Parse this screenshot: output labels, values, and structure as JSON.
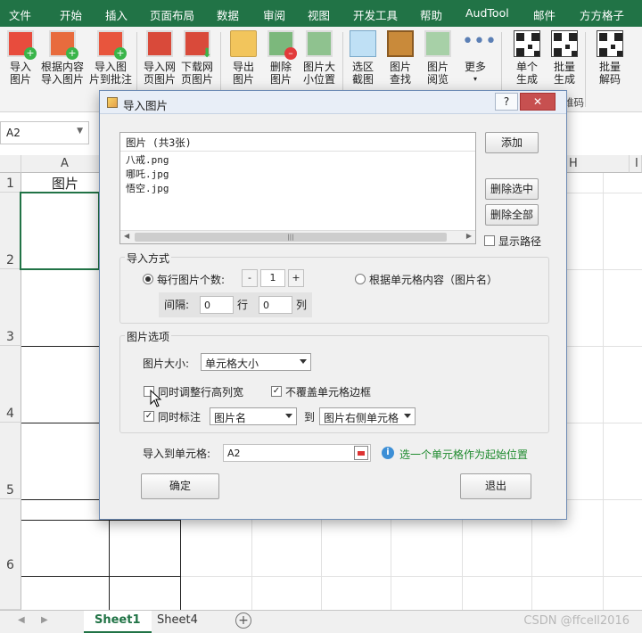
{
  "menubar": {
    "items": [
      "文件",
      "开始",
      "插入",
      "页面布局",
      "数据",
      "审阅",
      "视图",
      "开发工具",
      "帮助",
      "AudTool",
      "邮件",
      "方方格子"
    ]
  },
  "ribbon": {
    "buttons": [
      {
        "line1": "导入",
        "line2": "图片",
        "icon": "import-image-icon"
      },
      {
        "line1": "根据内容",
        "line2": "导入图片",
        "icon": "import-by-content-icon"
      },
      {
        "line1": "导入图",
        "line2": "片到批注",
        "icon": "image-to-comment-icon"
      },
      {
        "line1": "导入网",
        "line2": "页图片",
        "icon": "import-web-image-icon"
      },
      {
        "line1": "下载网",
        "line2": "页图片",
        "icon": "download-web-image-icon"
      },
      {
        "line1": "导出",
        "line2": "图片",
        "icon": "export-image-icon"
      },
      {
        "line1": "删除",
        "line2": "图片",
        "icon": "delete-image-icon"
      },
      {
        "line1": "图片大",
        "line2": "小位置",
        "icon": "image-size-position-icon"
      },
      {
        "line1": "选区",
        "line2": "截图",
        "icon": "selection-screenshot-icon"
      },
      {
        "line1": "图片",
        "line2": "查找",
        "icon": "image-find-icon"
      },
      {
        "line1": "图片",
        "line2": "阅览",
        "icon": "image-view-icon"
      },
      {
        "line1": "更多",
        "line2": "",
        "icon": "more-icon"
      },
      {
        "line1": "单个",
        "line2": "生成",
        "icon": "qr-single-icon"
      },
      {
        "line1": "批量",
        "line2": "生成",
        "icon": "qr-batch-icon"
      },
      {
        "line1": "批量",
        "line2": "解码",
        "icon": "qr-decode-icon"
      }
    ],
    "group_label_tail": "维码"
  },
  "namebox": {
    "value": "A2"
  },
  "grid": {
    "col_a": "A",
    "col_h": "H",
    "col_i": "I",
    "rows": [
      "1",
      "2",
      "3",
      "4",
      "5",
      "6"
    ],
    "a1_value": "图片"
  },
  "sheets": {
    "tabs": [
      "Sheet1",
      "Sheet4"
    ],
    "active": "Sheet1"
  },
  "watermark": "CSDN @ffcell2016",
  "dialog": {
    "title": "导入图片",
    "help": "?",
    "close": "✕",
    "list_header": "图片 (共3张)",
    "files": [
      "八戒.png",
      "哪吒.jpg",
      "悟空.jpg"
    ],
    "add": "添加",
    "delete_selected": "删除选中",
    "delete_all": "删除全部",
    "show_path": "显示路径",
    "import_mode": {
      "label": "导入方式",
      "per_row_label": "每行图片个数:",
      "per_row_value": "1",
      "by_content_label": "根据单元格内容（图片名）",
      "spacing_label": "间隔:",
      "row_spacing": "0",
      "row_unit": "行",
      "col_spacing": "0",
      "col_unit": "列"
    },
    "image_options": {
      "label": "图片选项",
      "size_label": "图片大小:",
      "size_value": "单元格大小",
      "adjust_label": "同时调整行高列宽",
      "adjust_checked": false,
      "no_cover_label": "不覆盖单元格边框",
      "no_cover_checked": true,
      "annotate_label": "同时标注",
      "annotate_checked": true,
      "annotate_source": "图片名",
      "to_label": "到",
      "annotate_target": "图片右侧单元格"
    },
    "target_label": "导入到单元格:",
    "target_value": "A2",
    "hint": "选一个单元格作为起始位置",
    "ok": "确定",
    "cancel": "退出"
  }
}
